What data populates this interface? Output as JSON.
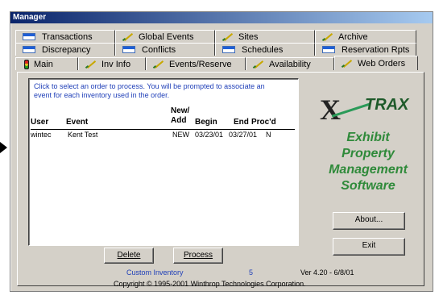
{
  "window": {
    "title": "Manager"
  },
  "tabs": {
    "row1": [
      "Transactions",
      "Global Events",
      "Sites",
      "Archive"
    ],
    "row2": [
      "Discrepancy",
      "Conflicts",
      "Schedules",
      "Reservation Rpts"
    ],
    "row3": [
      "Main",
      "Inv Info",
      "Events/Reserve",
      "Availability",
      "Web Orders"
    ]
  },
  "orders": {
    "instructions": "Click to select an order to process.  You will be prompted to associate an event for each inventory used in the order.",
    "headers": {
      "user": "User",
      "event": "Event",
      "new_add": "New/\nAdd",
      "begin": "Begin",
      "end": "End",
      "procd": "Proc'd"
    },
    "rows": [
      {
        "user": "wintec",
        "event": "Kent Test",
        "new_add": "NEW",
        "begin": "03/23/01",
        "end": "03/27/01",
        "procd": "N"
      }
    ],
    "delete_label": "Delete",
    "process_label": "Process"
  },
  "logo": {
    "x": "X",
    "trax": "TRAX",
    "tagline": "Exhibit\nProperty\nManagement\nSoftware"
  },
  "buttons": {
    "about": "About...",
    "exit": "Exit"
  },
  "footer": {
    "custom_inventory": "Custom Inventory",
    "count": "5",
    "version": "Ver 4.20 - 6/8/01",
    "copyright": "Copyright © 1995-2001  Winthrop Technologies Corporation."
  },
  "colors": {
    "title_start": "#0a246a",
    "link": "#1f3fb8",
    "logo_green": "#2f8a3a"
  }
}
